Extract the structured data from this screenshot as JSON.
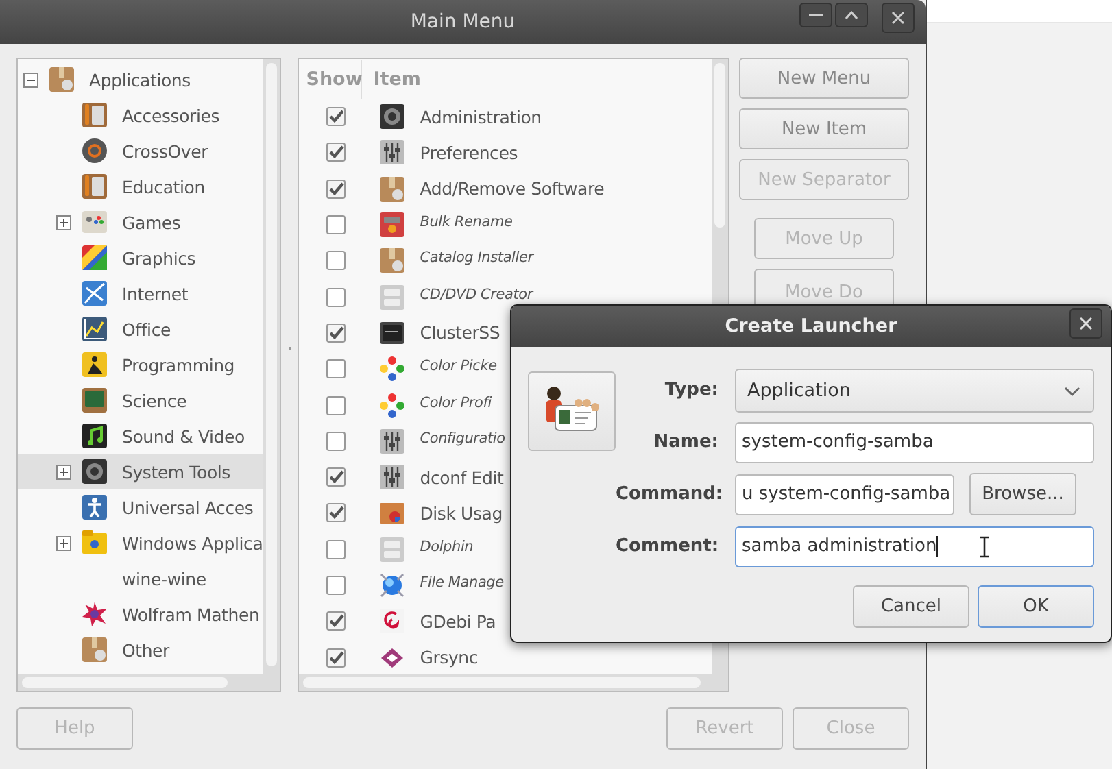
{
  "window": {
    "title": "Main Menu"
  },
  "tree": [
    {
      "label": "Applications",
      "expanded": true,
      "selected": false,
      "children": [
        {
          "label": "Accessories",
          "selected": false
        },
        {
          "label": "CrossOver",
          "selected": false
        },
        {
          "label": "Education",
          "selected": false
        },
        {
          "label": "Games",
          "expanded": false,
          "selected": false
        },
        {
          "label": "Graphics",
          "selected": false
        },
        {
          "label": "Internet",
          "selected": false
        },
        {
          "label": "Office",
          "selected": false
        },
        {
          "label": "Programming",
          "selected": false
        },
        {
          "label": "Science",
          "selected": false
        },
        {
          "label": "Sound & Video",
          "selected": false
        },
        {
          "label": "System Tools",
          "expanded": false,
          "selected": true
        },
        {
          "label": "Universal Acces",
          "selected": false
        },
        {
          "label": "Windows Applica",
          "expanded": false,
          "selected": false
        },
        {
          "label": "wine-wine",
          "selected": false
        },
        {
          "label": "Wolfram Mathen",
          "selected": false
        },
        {
          "label": "Other",
          "selected": false
        }
      ]
    }
  ],
  "items": {
    "columns": [
      "Show",
      "Item"
    ],
    "rows": [
      {
        "name": "Administration",
        "checked": true
      },
      {
        "name": "Preferences",
        "checked": true
      },
      {
        "name": "Add/Remove Software",
        "checked": true
      },
      {
        "name": "Bulk Rename",
        "checked": false
      },
      {
        "name": "Catalog Installer",
        "checked": false
      },
      {
        "name": "CD/DVD Creator",
        "checked": false
      },
      {
        "name": "ClusterSS",
        "checked": true
      },
      {
        "name": "Color Picke",
        "checked": false
      },
      {
        "name": "Color Profi",
        "checked": false
      },
      {
        "name": "Configuratio",
        "checked": false
      },
      {
        "name": "dconf Edit",
        "checked": true
      },
      {
        "name": "Disk Usag",
        "checked": true
      },
      {
        "name": "Dolphin",
        "checked": false
      },
      {
        "name": "File Manage",
        "checked": false
      },
      {
        "name": "GDebi Pa",
        "checked": true
      },
      {
        "name": "Grsync",
        "checked": true
      }
    ]
  },
  "side_buttons": [
    {
      "label": "New Menu",
      "disabled": false
    },
    {
      "label": "New Item",
      "disabled": false
    },
    {
      "label": "New Separator",
      "disabled": true
    },
    {
      "label": "Move Up",
      "disabled": true
    },
    {
      "label": "Move Do",
      "disabled": true
    }
  ],
  "bottom_buttons": {
    "help": "Help",
    "revert": "Revert",
    "close": "Close"
  },
  "dialog": {
    "title": "Create Launcher",
    "fields": [
      {
        "kind": "dropdown",
        "label": "Type:",
        "value": "Application"
      },
      {
        "kind": "text",
        "label": "Name:",
        "value": "system-config-samba"
      },
      {
        "kind": "browse",
        "label": "Command:",
        "value": "u system-config-samba",
        "button": "Browse..."
      },
      {
        "kind": "focused",
        "label": "Comment:",
        "value": "samba administration"
      }
    ],
    "buttons": [
      {
        "label": "Cancel",
        "default": false
      },
      {
        "label": "OK",
        "default": true
      }
    ]
  }
}
